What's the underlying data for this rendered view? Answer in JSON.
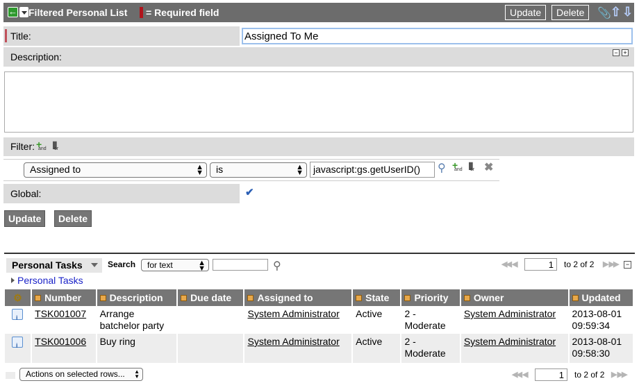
{
  "header": {
    "title": "Filtered Personal List",
    "required_legend": "= Required field",
    "update_label": "Update",
    "delete_label": "Delete"
  },
  "form": {
    "title_label": "Title:",
    "title_value": "Assigned To Me",
    "description_label": "Description:",
    "filter_label": "Filter:",
    "filter_and": "and",
    "filter_or": "or",
    "condition": {
      "field": "Assigned to",
      "operator": "is",
      "value": "javascript:gs.getUserID()"
    },
    "global_label": "Global:",
    "global_checked": true,
    "update_label": "Update",
    "delete_label": "Delete"
  },
  "list": {
    "title": "Personal Tasks",
    "search_label": "Search",
    "search_mode": "for text",
    "search_value": "",
    "page_input": "1",
    "range_text": "to 2 of 2",
    "breadcrumb": "Personal Tasks",
    "columns": [
      "Number",
      "Description",
      "Due date",
      "Assigned to",
      "State",
      "Priority",
      "Owner",
      "Updated"
    ],
    "rows": [
      {
        "number": "TSK001007",
        "description": [
          "Arrange",
          "batchelor party"
        ],
        "due_date": "",
        "assigned_to": "System Administrator",
        "state": "Active",
        "priority": [
          "2 -",
          "Moderate"
        ],
        "owner": "System Administrator",
        "updated": [
          "2013-08-01",
          "09:59:34"
        ]
      },
      {
        "number": "TSK001006",
        "description": [
          "Buy ring"
        ],
        "due_date": "",
        "assigned_to": "System Administrator",
        "state": "Active",
        "priority": [
          "2 -",
          "Moderate"
        ],
        "owner": "System Administrator",
        "updated": [
          "2013-08-01",
          "09:58:30"
        ]
      }
    ],
    "actions_label": "Actions on selected rows...",
    "footer_page_input": "1",
    "footer_range_text": "to 2 of 2"
  },
  "colors": {
    "header_bg": "#6c6c6c",
    "label_bg": "#dcdcdc",
    "link": "#1a22c8",
    "required": "#b0141c"
  },
  "icons": [
    "back-arrow-icon",
    "menu-arrow-icon",
    "attachment-icon",
    "previous-record-icon",
    "next-record-icon",
    "add-and-icon",
    "add-or-icon",
    "magnify-icon",
    "delete-x-icon",
    "checkbox-icon",
    "gear-icon",
    "record-info-icon"
  ]
}
